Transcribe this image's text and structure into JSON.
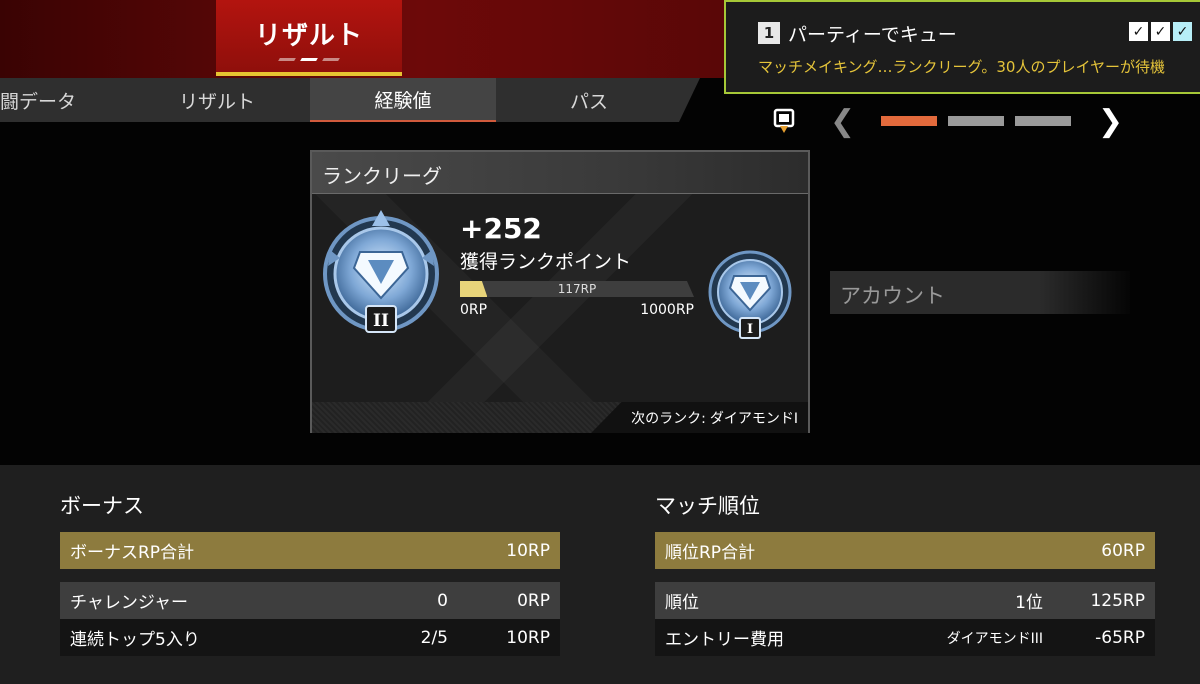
{
  "header": {
    "title": "リザルト",
    "tabs": [
      {
        "label": "闘データ"
      },
      {
        "label": "リザルト"
      },
      {
        "label": "経験値"
      },
      {
        "label": "パス"
      }
    ]
  },
  "party": {
    "queue_number": "1",
    "title": "パーティーでキュー",
    "status": "マッチメイキング…ランクリーグ。30人のプレイヤーが待機",
    "checks": [
      "✓",
      "✓",
      "✓"
    ]
  },
  "pager": {
    "pages": 3,
    "current_page": 1
  },
  "rank_card": {
    "title": "ランクリーグ",
    "gain": "+252",
    "gain_label": "獲得ランクポイント",
    "progress_current": "117RP",
    "progress_min": "0RP",
    "progress_max": "1000RP",
    "progress_fraction": 0.117,
    "current_tier_numeral": "II",
    "next_tier_numeral": "I",
    "next_rank_label": "次のランク:",
    "next_rank_value": "ダイアモンドI"
  },
  "account": {
    "label": "アカウント"
  },
  "bonus": {
    "title": "ボーナス",
    "total": {
      "label": "ボーナスRP合計",
      "rp": "10RP"
    },
    "rows": [
      {
        "label": "チャレンジャー",
        "value": "0",
        "rp": "0RP"
      },
      {
        "label": "連続トップ5入り",
        "value": "2/5",
        "rp": "10RP"
      }
    ]
  },
  "placement": {
    "title": "マッチ順位",
    "total": {
      "label": "順位RP合計",
      "rp": "60RP"
    },
    "rows": [
      {
        "label": "順位",
        "value": "1位",
        "rp": "125RP"
      },
      {
        "label": "エントリー費用",
        "value": "ダイアモンドIII",
        "rp": "-65RP"
      }
    ]
  },
  "colors": {
    "accent_red": "#b3140f",
    "accent_gold": "#e7c431",
    "party_border": "#a6c837",
    "pager_active": "#e36a3c",
    "total_row": "#8d7b3e"
  }
}
